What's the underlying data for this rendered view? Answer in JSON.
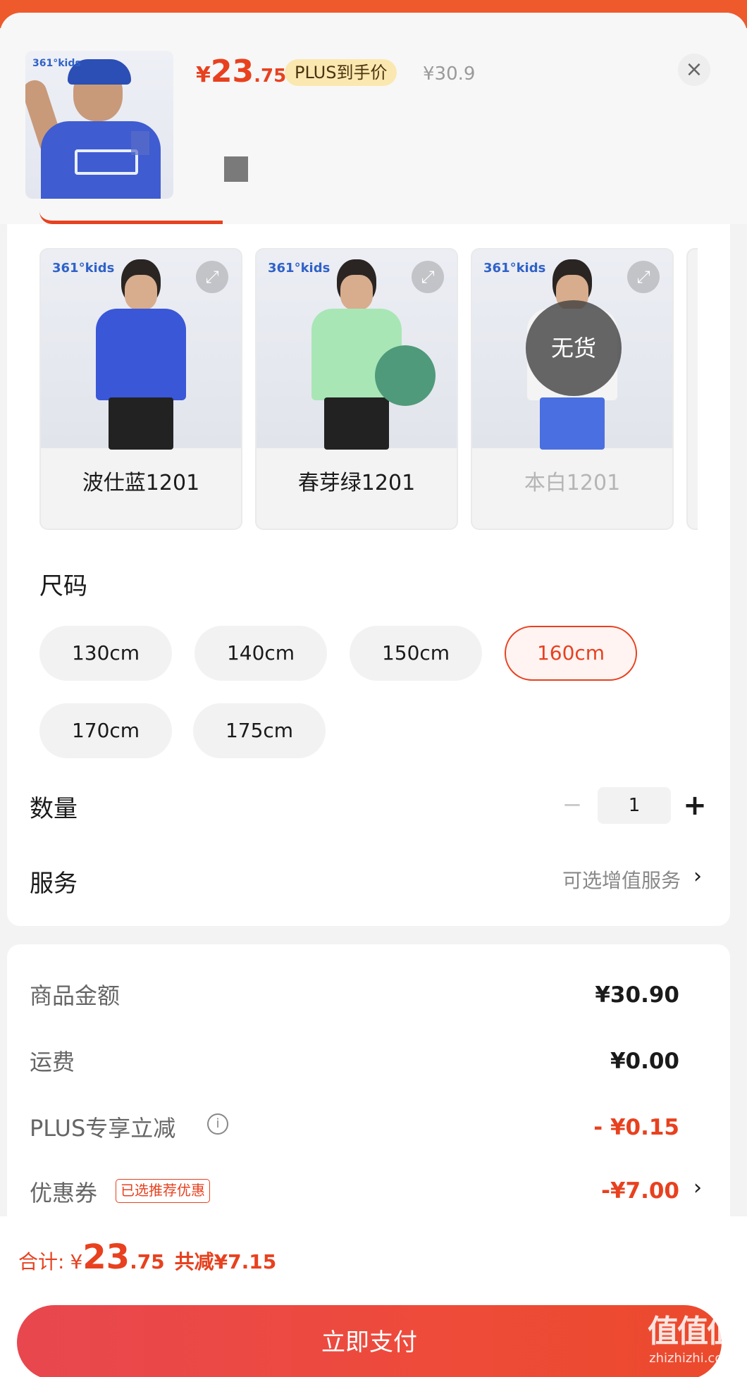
{
  "header": {
    "price_symbol": "¥",
    "price_int": "23",
    "price_dec": ".75",
    "plus_tag": "PLUS到手价",
    "original_price": "¥30.9",
    "close_icon": "×",
    "thumb_brand": "361°kids"
  },
  "colors": {
    "items": [
      {
        "label": "波仕蓝1201",
        "shirt_color": "#3a57d8",
        "sold_out": false
      },
      {
        "label": "春芽绿1201",
        "shirt_color": "#a9e6b6",
        "sold_out": false
      },
      {
        "label": "本白1201",
        "shirt_color": "#f4f4f4",
        "sold_out": true
      }
    ],
    "sold_out_label": "无货",
    "brand_logo": "361°kids",
    "expand_icon": "⤢"
  },
  "size": {
    "title": "尺码",
    "options": [
      "130cm",
      "140cm",
      "150cm",
      "160cm",
      "170cm",
      "175cm"
    ],
    "selected": "160cm"
  },
  "quantity": {
    "title": "数量",
    "value": "1",
    "minus": "−",
    "plus": "+"
  },
  "service": {
    "title": "服务",
    "value": "可选增值服务",
    "chevron": "›"
  },
  "fees": {
    "goods_label": "商品金额",
    "goods_value": "¥30.90",
    "shipping_label": "运费",
    "shipping_value": "¥0.00",
    "plus_label": "PLUS专享立减",
    "plus_value": "- ¥0.15",
    "info_icon": "i",
    "coupon_label": "优惠券",
    "coupon_tag": "已选推荐优惠",
    "coupon_value": "-¥7.00",
    "chevron": "›"
  },
  "footer": {
    "total_label": "合计:",
    "total_symbol": "¥",
    "total_int": "23",
    "total_dec": ".75",
    "total_save": "共减¥7.15",
    "pay_button": "立即支付",
    "watermark_big": "值值值",
    "watermark_small": "zhizhizhi.com"
  },
  "accent": "#e8411f"
}
